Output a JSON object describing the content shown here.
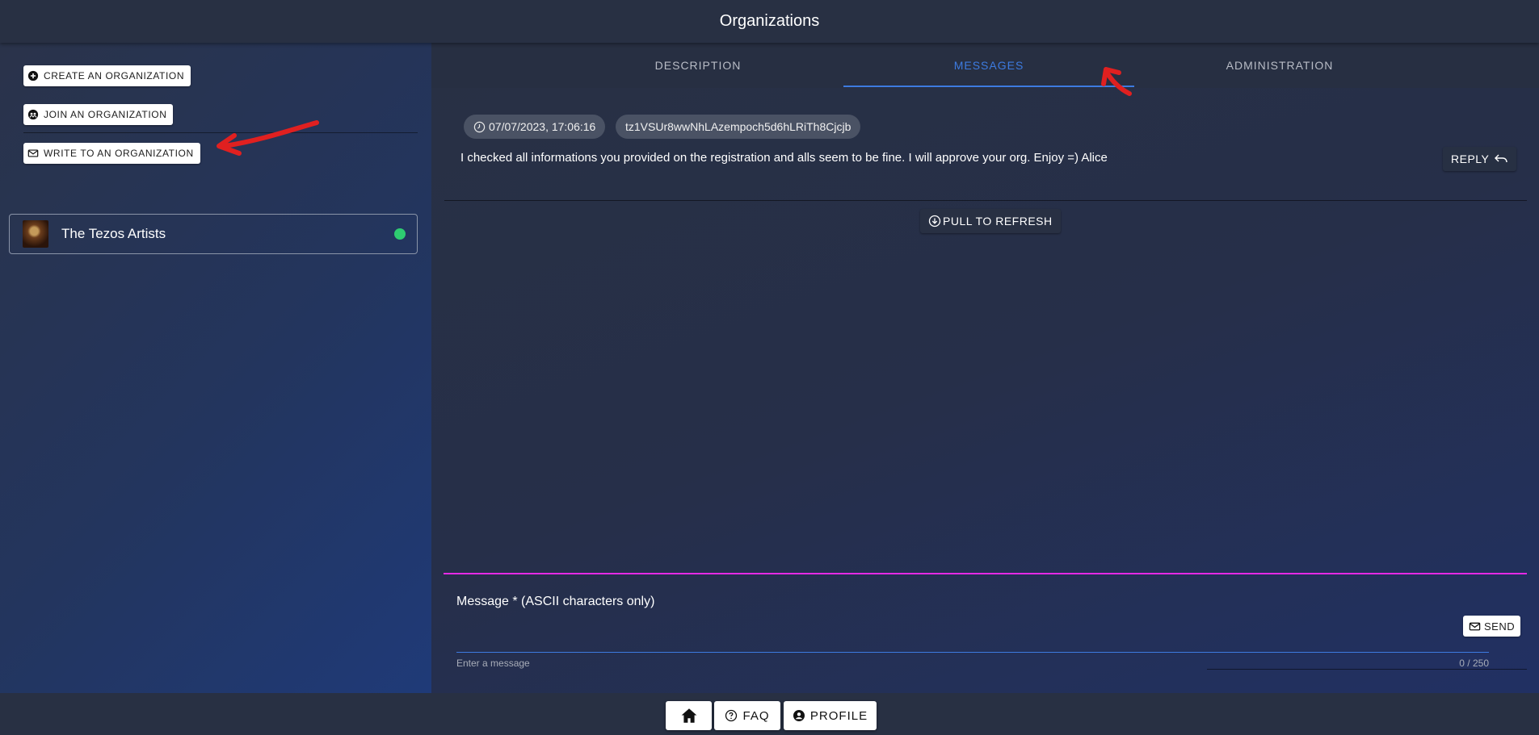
{
  "header": {
    "title": "Organizations"
  },
  "sidebar": {
    "create_label": "CREATE AN ORGANIZATION",
    "join_label": "JOIN AN ORGANIZATION",
    "write_label": "WRITE TO AN ORGANIZATION",
    "organizations": [
      {
        "name": "The Tezos Artists",
        "status_color": "#2ecc71"
      }
    ]
  },
  "tabs": {
    "items": [
      {
        "label": "DESCRIPTION"
      },
      {
        "label": "MESSAGES"
      },
      {
        "label": "ADMINISTRATION"
      }
    ],
    "active": "MESSAGES"
  },
  "messages": {
    "items": [
      {
        "timestamp": "07/07/2023, 17:06:16",
        "sender": "tz1VSUr8wwNhLAzempoch5d6hLRiTh8Cjcjb",
        "text": "I checked all informations you provided on the registration and alls seem to be fine. I will approve your org. Enjoy =)  Alice",
        "reply_label": "REPLY"
      }
    ],
    "refresh_label": "PULL TO REFRESH"
  },
  "composer": {
    "label": "Message * (ASCII characters only)",
    "value": "",
    "hint": "Enter a message",
    "counter": "0 / 250",
    "send_label": "SEND"
  },
  "footer": {
    "faq_label": "FAQ",
    "profile_label": "PROFILE"
  },
  "colors": {
    "accent": "#3d7be0",
    "focus_line": "#e52ae5",
    "annotation_arrow": "#e02020"
  }
}
